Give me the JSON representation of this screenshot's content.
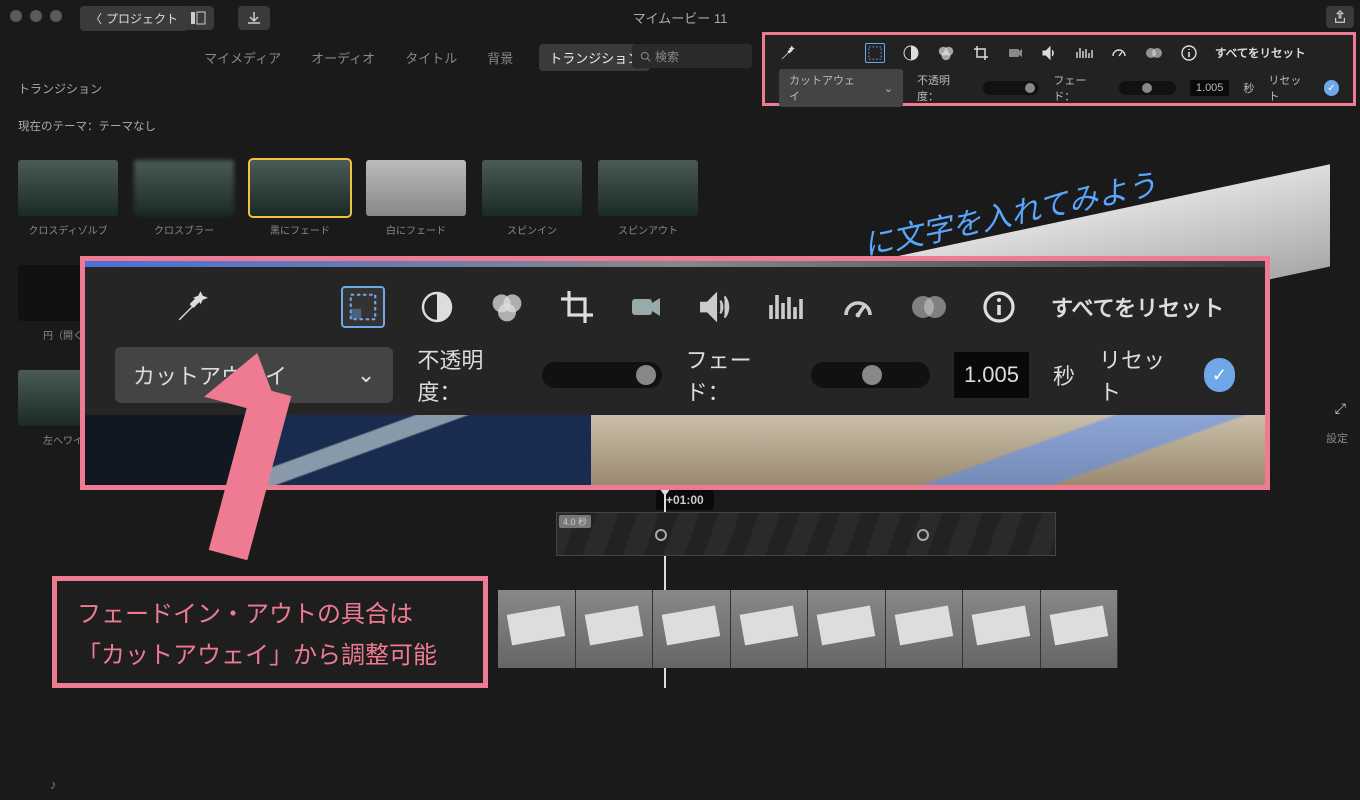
{
  "window": {
    "title": "マイムービー 11",
    "back": "プロジェクト"
  },
  "tabs": {
    "mymedia": "マイメディア",
    "audio": "オーディオ",
    "title": "タイトル",
    "bg": "背景",
    "transition": "トランジション"
  },
  "search": {
    "placeholder": "検索"
  },
  "section": "トランジション",
  "theme": "現在のテーマ：テーマなし",
  "thumbs": {
    "r1": [
      "クロスディゾルブ",
      "クロスブラー",
      "黒にフェード",
      "白にフェード",
      "スピンイン",
      "スピンアウト"
    ],
    "r2_0": "円（開く…",
    "r3_0": "左へワイ…"
  },
  "preview_text": "に文字を入れてみよう",
  "inspector": {
    "select": "カットアウェイ",
    "opacity_label": "不透明度：",
    "fade_label": "フェード：",
    "fade_value": "1.005",
    "fade_unit": "秒",
    "reset": "リセット",
    "reset_all": "すべてをリセット"
  },
  "timeline": {
    "time": "+01:00",
    "clip_dur": "4.0 秒"
  },
  "annotation": {
    "l1": "フェードイン・アウトの具合は",
    "l2": "「カットアウェイ」から調整可能"
  },
  "settings": "設定"
}
